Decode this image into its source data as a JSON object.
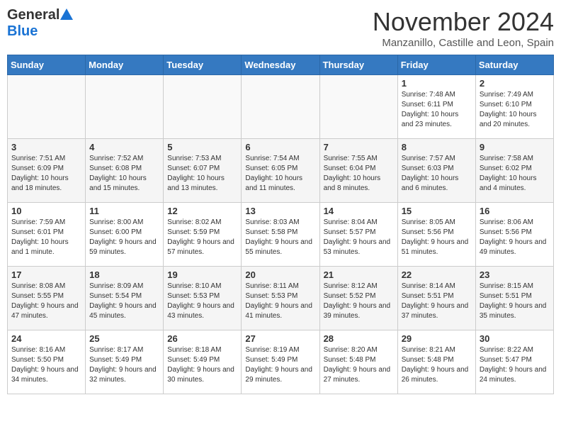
{
  "header": {
    "logo_general": "General",
    "logo_blue": "Blue",
    "month_title": "November 2024",
    "location": "Manzanillo, Castille and Leon, Spain"
  },
  "calendar": {
    "days_of_week": [
      "Sunday",
      "Monday",
      "Tuesday",
      "Wednesday",
      "Thursday",
      "Friday",
      "Saturday"
    ],
    "weeks": [
      [
        {
          "day": "",
          "info": ""
        },
        {
          "day": "",
          "info": ""
        },
        {
          "day": "",
          "info": ""
        },
        {
          "day": "",
          "info": ""
        },
        {
          "day": "",
          "info": ""
        },
        {
          "day": "1",
          "info": "Sunrise: 7:48 AM\nSunset: 6:11 PM\nDaylight: 10 hours and 23 minutes."
        },
        {
          "day": "2",
          "info": "Sunrise: 7:49 AM\nSunset: 6:10 PM\nDaylight: 10 hours and 20 minutes."
        }
      ],
      [
        {
          "day": "3",
          "info": "Sunrise: 7:51 AM\nSunset: 6:09 PM\nDaylight: 10 hours and 18 minutes."
        },
        {
          "day": "4",
          "info": "Sunrise: 7:52 AM\nSunset: 6:08 PM\nDaylight: 10 hours and 15 minutes."
        },
        {
          "day": "5",
          "info": "Sunrise: 7:53 AM\nSunset: 6:07 PM\nDaylight: 10 hours and 13 minutes."
        },
        {
          "day": "6",
          "info": "Sunrise: 7:54 AM\nSunset: 6:05 PM\nDaylight: 10 hours and 11 minutes."
        },
        {
          "day": "7",
          "info": "Sunrise: 7:55 AM\nSunset: 6:04 PM\nDaylight: 10 hours and 8 minutes."
        },
        {
          "day": "8",
          "info": "Sunrise: 7:57 AM\nSunset: 6:03 PM\nDaylight: 10 hours and 6 minutes."
        },
        {
          "day": "9",
          "info": "Sunrise: 7:58 AM\nSunset: 6:02 PM\nDaylight: 10 hours and 4 minutes."
        }
      ],
      [
        {
          "day": "10",
          "info": "Sunrise: 7:59 AM\nSunset: 6:01 PM\nDaylight: 10 hours and 1 minute."
        },
        {
          "day": "11",
          "info": "Sunrise: 8:00 AM\nSunset: 6:00 PM\nDaylight: 9 hours and 59 minutes."
        },
        {
          "day": "12",
          "info": "Sunrise: 8:02 AM\nSunset: 5:59 PM\nDaylight: 9 hours and 57 minutes."
        },
        {
          "day": "13",
          "info": "Sunrise: 8:03 AM\nSunset: 5:58 PM\nDaylight: 9 hours and 55 minutes."
        },
        {
          "day": "14",
          "info": "Sunrise: 8:04 AM\nSunset: 5:57 PM\nDaylight: 9 hours and 53 minutes."
        },
        {
          "day": "15",
          "info": "Sunrise: 8:05 AM\nSunset: 5:56 PM\nDaylight: 9 hours and 51 minutes."
        },
        {
          "day": "16",
          "info": "Sunrise: 8:06 AM\nSunset: 5:56 PM\nDaylight: 9 hours and 49 minutes."
        }
      ],
      [
        {
          "day": "17",
          "info": "Sunrise: 8:08 AM\nSunset: 5:55 PM\nDaylight: 9 hours and 47 minutes."
        },
        {
          "day": "18",
          "info": "Sunrise: 8:09 AM\nSunset: 5:54 PM\nDaylight: 9 hours and 45 minutes."
        },
        {
          "day": "19",
          "info": "Sunrise: 8:10 AM\nSunset: 5:53 PM\nDaylight: 9 hours and 43 minutes."
        },
        {
          "day": "20",
          "info": "Sunrise: 8:11 AM\nSunset: 5:53 PM\nDaylight: 9 hours and 41 minutes."
        },
        {
          "day": "21",
          "info": "Sunrise: 8:12 AM\nSunset: 5:52 PM\nDaylight: 9 hours and 39 minutes."
        },
        {
          "day": "22",
          "info": "Sunrise: 8:14 AM\nSunset: 5:51 PM\nDaylight: 9 hours and 37 minutes."
        },
        {
          "day": "23",
          "info": "Sunrise: 8:15 AM\nSunset: 5:51 PM\nDaylight: 9 hours and 35 minutes."
        }
      ],
      [
        {
          "day": "24",
          "info": "Sunrise: 8:16 AM\nSunset: 5:50 PM\nDaylight: 9 hours and 34 minutes."
        },
        {
          "day": "25",
          "info": "Sunrise: 8:17 AM\nSunset: 5:49 PM\nDaylight: 9 hours and 32 minutes."
        },
        {
          "day": "26",
          "info": "Sunrise: 8:18 AM\nSunset: 5:49 PM\nDaylight: 9 hours and 30 minutes."
        },
        {
          "day": "27",
          "info": "Sunrise: 8:19 AM\nSunset: 5:49 PM\nDaylight: 9 hours and 29 minutes."
        },
        {
          "day": "28",
          "info": "Sunrise: 8:20 AM\nSunset: 5:48 PM\nDaylight: 9 hours and 27 minutes."
        },
        {
          "day": "29",
          "info": "Sunrise: 8:21 AM\nSunset: 5:48 PM\nDaylight: 9 hours and 26 minutes."
        },
        {
          "day": "30",
          "info": "Sunrise: 8:22 AM\nSunset: 5:47 PM\nDaylight: 9 hours and 24 minutes."
        }
      ]
    ]
  }
}
